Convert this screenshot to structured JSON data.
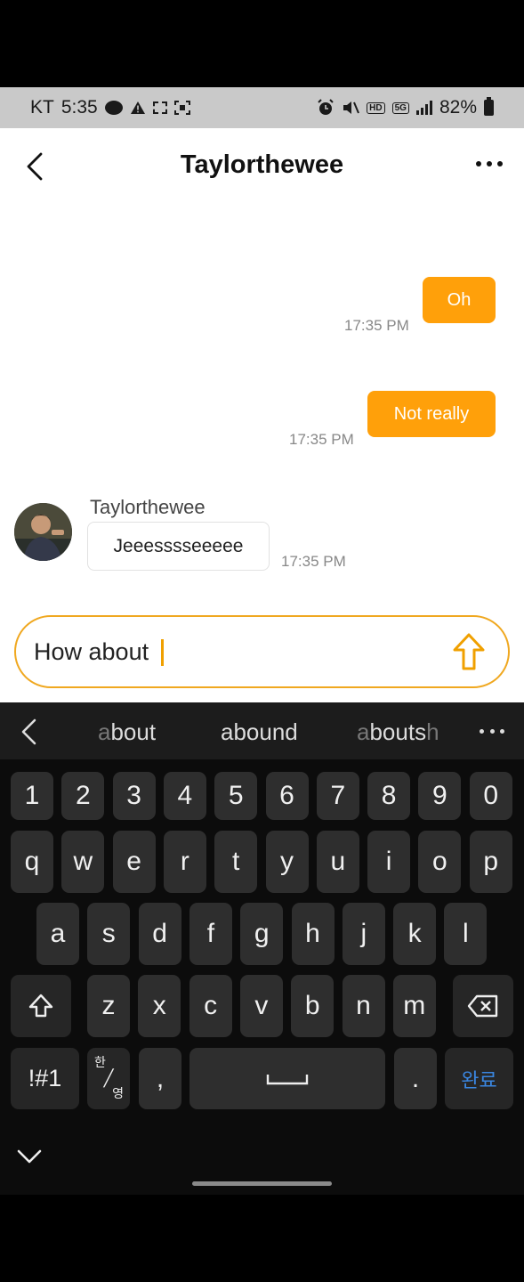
{
  "status_bar": {
    "carrier": "KT",
    "time": "5:35",
    "talk_icon_text": "TALK",
    "hd_label": "HD",
    "network": "5G",
    "battery": "82%"
  },
  "header": {
    "title": "Taylorthewee"
  },
  "messages": [
    {
      "direction": "out",
      "text": "Oh",
      "time": "17:35 PM"
    },
    {
      "direction": "out",
      "text": "Not really",
      "time": "17:35 PM"
    },
    {
      "direction": "in",
      "sender": "Taylorthewee",
      "text": "Jeeesssseeeee",
      "time": "17:35 PM"
    }
  ],
  "composer": {
    "value": "How about "
  },
  "keyboard": {
    "suggestions": [
      {
        "match": "a",
        "rest": "bout",
        "dim": ""
      },
      {
        "match": "abound",
        "rest": "",
        "dim": "d"
      },
      {
        "match": "a",
        "rest": "bouts",
        "dim": "h"
      }
    ],
    "row_numbers": [
      "1",
      "2",
      "3",
      "4",
      "5",
      "6",
      "7",
      "8",
      "9",
      "0"
    ],
    "row_top": [
      "q",
      "w",
      "e",
      "r",
      "t",
      "y",
      "u",
      "i",
      "o",
      "p"
    ],
    "row_mid": [
      "a",
      "s",
      "d",
      "f",
      "g",
      "h",
      "j",
      "k",
      "l"
    ],
    "row_bottom": [
      "z",
      "x",
      "c",
      "v",
      "b",
      "n",
      "m"
    ],
    "symbols_key": "!#1",
    "lang_key_top": "한",
    "lang_key_bottom": "영",
    "comma_key": ",",
    "period_key": ".",
    "done_key": "완료"
  },
  "colors": {
    "accent": "#ffa00a",
    "keyboard_bg": "#0c0c0c",
    "key_bg": "#2e2e2e",
    "done_blue": "#3a86e0"
  }
}
